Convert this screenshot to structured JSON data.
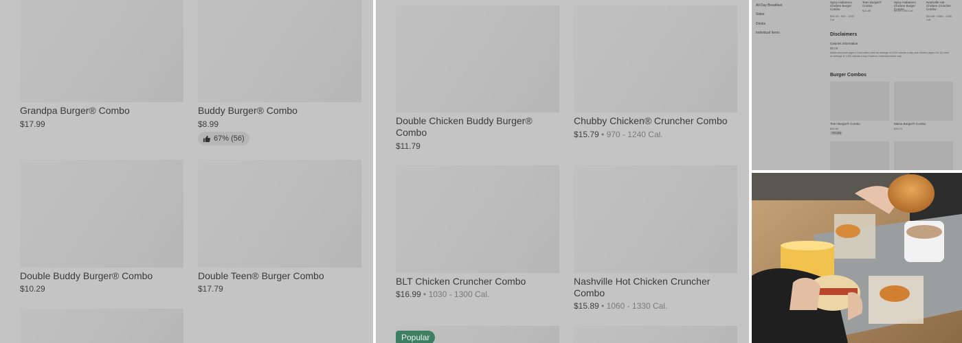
{
  "panel_left": {
    "items": [
      {
        "name": "Grandpa Burger® Combo",
        "price": "$17.99"
      },
      {
        "name": "Buddy Burger® Combo",
        "price": "$8.99",
        "rating": "67% (56)"
      },
      {
        "name": "Double Buddy Burger® Combo",
        "price": "$10.29"
      },
      {
        "name": "Double Teen® Burger Combo",
        "price": "$17.79"
      }
    ]
  },
  "panel_middle": {
    "items": [
      {
        "name_line1": "Double Chicken Buddy Burger®",
        "name_line2": "Combo",
        "price": "$11.79"
      },
      {
        "name_line1": "Chubby Chicken® Cruncher Combo",
        "price": "$15.79",
        "calories": " • 970 - 1240 Cal."
      },
      {
        "name_line1": "BLT Chicken Cruncher Combo",
        "price": "$16.99",
        "calories": " • 1030 - 1300 Cal."
      },
      {
        "name_line1": "Nashville Hot Chicken Cruncher",
        "name_line2": "Combo",
        "price": "$15.89",
        "calories": " • 1060 - 1330 Cal."
      }
    ],
    "badge": "Popular"
  },
  "panel_small": {
    "sidebar": [
      "All Day Breakfast",
      "Sides",
      "Drinks",
      "Individual Items"
    ],
    "top_items": [
      {
        "name": "Spicy Habanero Chicken Burger Combo",
        "price": "$15.29 • 930 - 1200 Cal."
      },
      {
        "name": "Teen Burger® Combo",
        "price": "$15.59"
      },
      {
        "name": "Spicy Habanero Chicken Burger Combo",
        "price": "$9.59 • 550 Cal."
      },
      {
        "name": "Nashville Hot Chicken Cruncher Combo",
        "price": "$15.89 • 1060 - 1330 Cal."
      }
    ],
    "disclaimers_title": "Disclaimers",
    "calories_info_title": "Calories Information",
    "calories_info_value": "$0.00",
    "calories_info_text": "Adults and youth (ages 13 and older) need an average of 2,000 calories a day, and children (ages 4 to 12) need an average of 1,500 calories a day. However, individual needs vary.",
    "section_title": "Burger Combos",
    "combo_items": [
      {
        "name": "Teen Burger® Combo",
        "price": "$15.59",
        "rating": "79% (89)"
      },
      {
        "name": "Mama Burger® Combo",
        "price": "$15.79"
      }
    ]
  },
  "colors": {
    "overlay_gray": "#c4c4c4",
    "popular_badge": "#3f7f61"
  }
}
